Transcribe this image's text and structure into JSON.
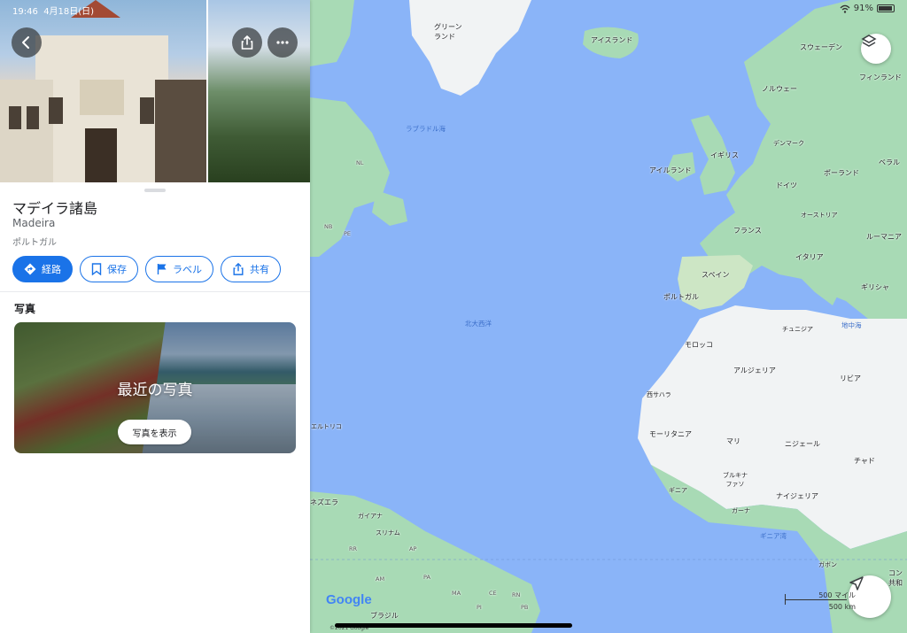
{
  "status_bar": {
    "time": "19:46",
    "date": "4月18日(日)",
    "battery": "91%",
    "battery_level": 0.91
  },
  "place": {
    "title": "マデイラ諸島",
    "subtitle": "Madeira",
    "region": "ポルトガル"
  },
  "actions": {
    "directions": "経路",
    "save": "保存",
    "label": "ラベル",
    "share": "共有"
  },
  "photos": {
    "section_title": "写真",
    "caption": "最近の写真",
    "button": "写真を表示"
  },
  "map": {
    "labels": {
      "greenland": "グリーン\nランド",
      "iceland": "アイスランド",
      "sweden": "スウェーデン",
      "finland": "フィンランド",
      "norway": "ノルウェー",
      "labrador_sea": "ラブラドル海",
      "denmark": "デンマーク",
      "uk": "イギリス",
      "ireland": "アイルランド",
      "belarus": "ベラル",
      "germany": "ドイツ",
      "poland": "ポーランド",
      "austria": "オーストリア",
      "france": "フランス",
      "romania": "ルーマニア",
      "italy": "イタリア",
      "spain": "スペイン",
      "portugal": "ポルトガル",
      "greece": "ギリシャ",
      "north_atlantic": "北大西洋",
      "tunisia": "チュニジア",
      "mediterranean": "地中海",
      "morocco": "モロッコ",
      "algeria": "アルジェリア",
      "libya": "リビア",
      "western_sahara": "西サハラ",
      "puerto_rico": "エルトリコ",
      "mauritania": "モーリタニア",
      "mali": "マリ",
      "niger": "ニジェール",
      "chad": "チャド",
      "guinea": "ギニア",
      "burkina_faso": "ブルキナ\nファソ",
      "nigeria": "ナイジェリア",
      "ghana": "ガーナ",
      "venezuela": "ネズエラ",
      "guyana": "ガイアナ",
      "suriname": "スリナム",
      "gulf_of_guinea": "ギニア湾",
      "gabon": "ガボン",
      "congo": "コン\n共和",
      "brazil": "ブラジル",
      "nl": "NL",
      "nb": "NB",
      "pe": "PE",
      "rr": "RR",
      "ap": "AP",
      "am": "AM",
      "pa": "PA",
      "ma": "MA",
      "ce": "CE",
      "rn": "RN",
      "pb": "PB",
      "pi": "PI"
    },
    "scale_miles": "500 マイル",
    "scale_km": "500 km",
    "google": "Google",
    "copyright": "©2021 Google"
  },
  "icons": {
    "back": "back-arrow-icon",
    "share": "share-icon",
    "more": "more-horizontal-icon",
    "layers": "layers-icon",
    "navigation": "navigation-arrow-icon",
    "pin": "map-pin-icon"
  },
  "colors": {
    "accent": "#1a73e8",
    "pin": "#ea4335",
    "water": "#8ab4f8",
    "land_green": "#a8dab5",
    "land_light": "#f1f3f4"
  }
}
